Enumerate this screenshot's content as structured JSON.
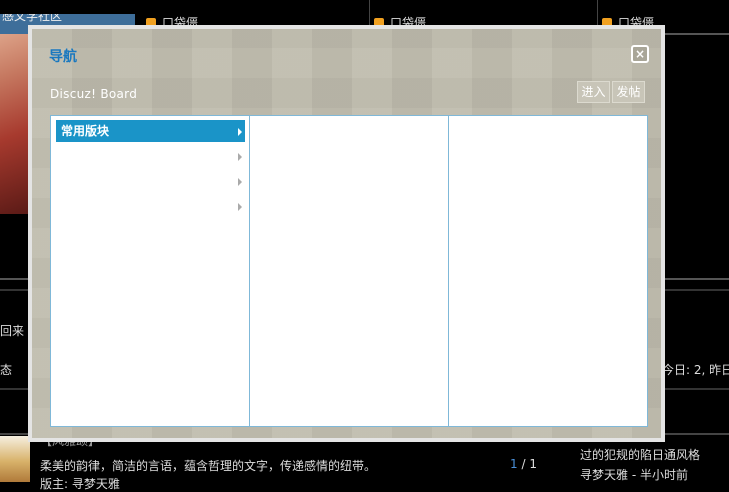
{
  "background": {
    "topbar_left": "感文学社区",
    "categories": [
      "口袋僵",
      "口袋僵",
      "口袋僵"
    ],
    "left_texts": [
      "回来",
      "态"
    ],
    "right_stats": "今日: 2, 昨日",
    "bottom_title": "【风雅颂】",
    "bottom_desc": "柔美的韵律，简洁的言语，蕴含哲理的文字，传递感情的纽带。",
    "bottom_moderator": "版主: 寻梦天雅",
    "pager_current": "1",
    "pager_sep": " / ",
    "pager_total": "1",
    "last_post_title": "过的犯规的陷日通风格",
    "last_post_meta": "寻梦天雅 - 半小时前"
  },
  "modal": {
    "title": "导航",
    "close_label": "×",
    "forum_name": "Discuz! Board",
    "buttons": {
      "enter": "进入",
      "post": "发帖"
    },
    "columns": [
      {
        "items": [
          {
            "label": "常用版块",
            "active": true
          },
          {
            "label": "",
            "active": false
          },
          {
            "label": "",
            "active": false
          },
          {
            "label": "",
            "active": false
          }
        ]
      },
      {
        "items": []
      },
      {
        "items": []
      }
    ]
  }
}
